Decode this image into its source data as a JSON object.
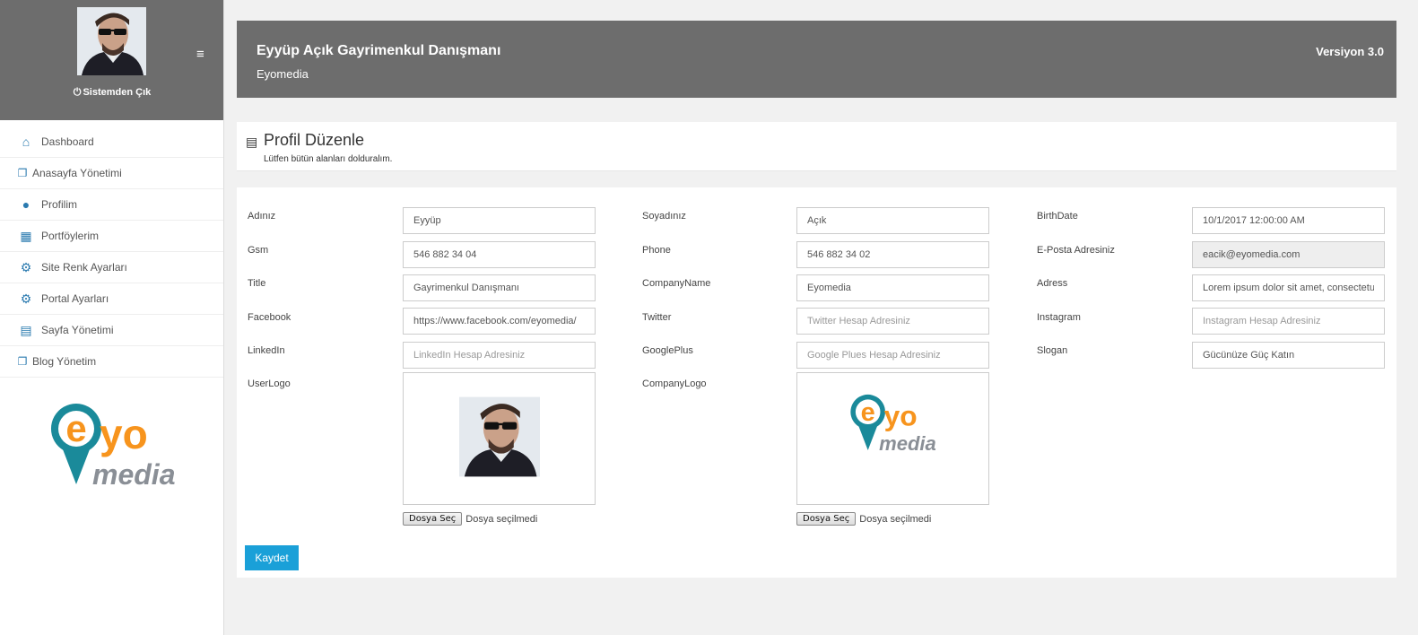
{
  "sidebar": {
    "logout_label": "Sistemden Çık",
    "menu": [
      {
        "label": "Dashboard",
        "icon": "home-icon"
      },
      {
        "label": "Anasayfa Yönetimi",
        "icon": "copy-icon"
      },
      {
        "label": "Profilim",
        "icon": "user-icon"
      },
      {
        "label": "Portföylerim",
        "icon": "building-icon"
      },
      {
        "label": "Site Renk Ayarları",
        "icon": "gear-icon"
      },
      {
        "label": "Portal Ayarları",
        "icon": "gear-icon"
      },
      {
        "label": "Sayfa Yönetimi",
        "icon": "document-icon"
      },
      {
        "label": "Blog Yönetim",
        "icon": "copy-icon"
      }
    ],
    "logo": {
      "e": "e",
      "yo": "yo",
      "media": "media"
    }
  },
  "header": {
    "title": "Eyyüp Açık Gayrimenkul Danışmanı",
    "subtitle": "Eyomedia",
    "version": "Versiyon 3.0"
  },
  "page": {
    "title": "Profil Düzenle",
    "subtitle": "Lütfen bütün alanları dolduralım."
  },
  "form": {
    "col1": [
      {
        "label": "Adınız",
        "value": "Eyyüp",
        "placeholder": ""
      },
      {
        "label": "Gsm",
        "value": "546 882 34 04",
        "placeholder": ""
      },
      {
        "label": "Title",
        "value": "Gayrimenkul Danışmanı",
        "placeholder": ""
      },
      {
        "label": "Facebook",
        "value": "https://www.facebook.com/eyomedia/",
        "placeholder": ""
      },
      {
        "label": "LinkedIn",
        "value": "",
        "placeholder": "LinkedIn Hesap Adresiniz"
      }
    ],
    "col2": [
      {
        "label": "Soyadınız",
        "value": "Açık",
        "placeholder": ""
      },
      {
        "label": "Phone",
        "value": "546 882 34 02",
        "placeholder": ""
      },
      {
        "label": "CompanyName",
        "value": "Eyomedia",
        "placeholder": ""
      },
      {
        "label": "Twitter",
        "value": "",
        "placeholder": "Twitter Hesap Adresiniz"
      },
      {
        "label": "GooglePlus",
        "value": "",
        "placeholder": "Google Plues Hesap Adresiniz"
      }
    ],
    "col3": [
      {
        "label": "BirthDate",
        "value": "10/1/2017 12:00:00 AM",
        "placeholder": ""
      },
      {
        "label": "E-Posta Adresiniz",
        "value": "eacik@eyomedia.com",
        "placeholder": ""
      },
      {
        "label": "Adress",
        "value": "Lorem ipsum dolor sit amet, consectetur",
        "placeholder": ""
      },
      {
        "label": "Instagram",
        "value": "",
        "placeholder": "Instagram Hesap Adresiniz"
      },
      {
        "label": "Slogan",
        "value": "Gücünüze Güç Katın",
        "placeholder": ""
      }
    ],
    "user_logo_label": "UserLogo",
    "company_logo_label": "CompanyLogo",
    "file_button": "Dosya Seç",
    "file_status": "Dosya seçilmedi",
    "save_label": "Kaydet"
  },
  "colors": {
    "accent": "#1aa0d8",
    "header_bg": "#6d6d6d",
    "logo_orange": "#f7941d",
    "logo_teal": "#1a8a9a"
  }
}
